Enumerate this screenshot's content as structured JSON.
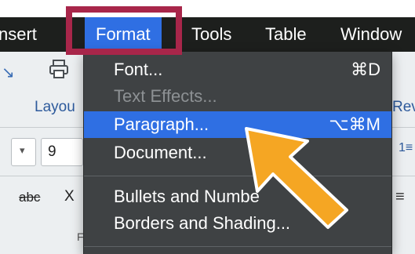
{
  "menubar": {
    "items": [
      {
        "label": "nsert"
      },
      {
        "label": "Format"
      },
      {
        "label": "Tools"
      },
      {
        "label": "Table"
      },
      {
        "label": "Window"
      }
    ]
  },
  "toolbar": {
    "layout_tab": "Layou",
    "review_tab": "Rev",
    "font_size": "9",
    "strikethrough_label": "abc",
    "subscript_label": "X",
    "bottom_label": "F"
  },
  "format_menu": {
    "items": [
      {
        "label": "Font...",
        "shortcut": "⌘D",
        "enabled": true
      },
      {
        "label": "Text Effects...",
        "shortcut": "",
        "enabled": false
      },
      {
        "label": "Paragraph...",
        "shortcut": "⌥⌘M",
        "enabled": true,
        "highlighted": true
      },
      {
        "label": "Document...",
        "shortcut": "",
        "enabled": true
      },
      {
        "label": "Bullets and Numbe",
        "shortcut": "",
        "enabled": true
      },
      {
        "label": "Borders and Shading...",
        "shortcut": "",
        "enabled": true
      }
    ]
  },
  "colors": {
    "menu_highlight": "#2f6fe3",
    "annotation_box": "#a8264a",
    "arrow": "#f5a623"
  },
  "annotations": {
    "arrow_icon": "arrow-pointer-icon"
  }
}
